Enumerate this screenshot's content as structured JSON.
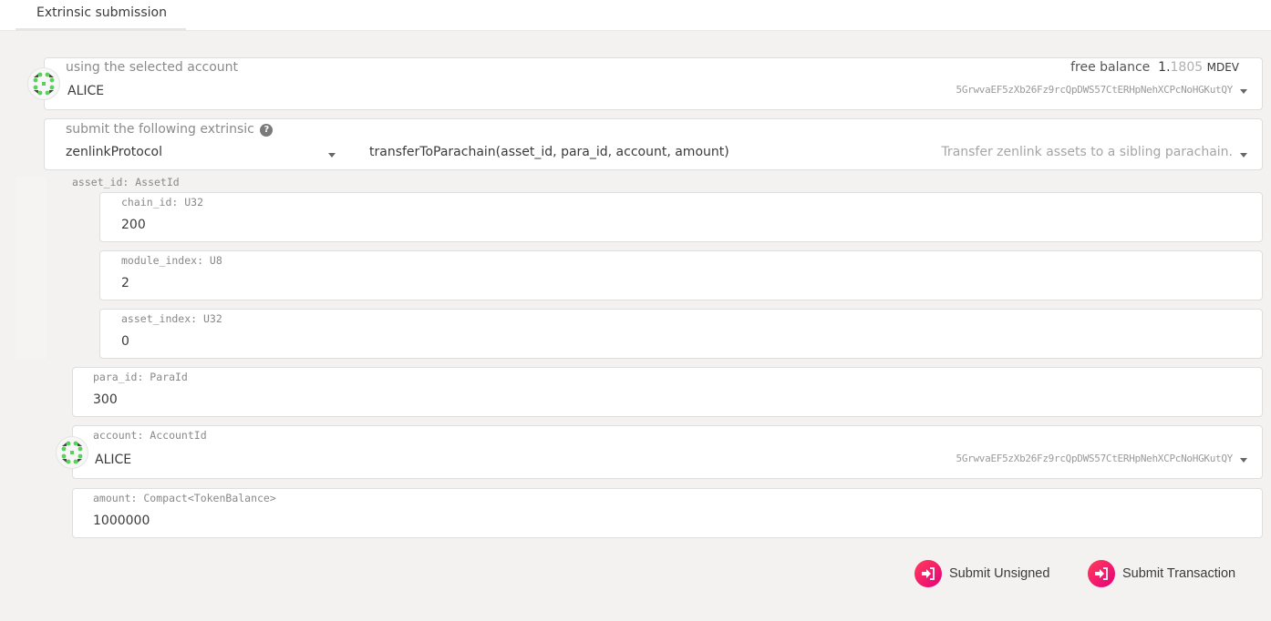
{
  "tabs": [
    {
      "label": "Extrinsic submission",
      "active": true
    }
  ],
  "account": {
    "label": "using the selected account",
    "name": "ALICE",
    "address": "5GrwvaEF5zXb26Fz9rcQpDWS57CtERHpNehXCPcNoHGKutQY",
    "balance_label": "free balance",
    "balance_int": "1.",
    "balance_dec": "1805",
    "balance_unit": "MDEV"
  },
  "extrinsic": {
    "label": "submit the following extrinsic",
    "help_icon": "?",
    "section": "zenlinkProtocol",
    "method": "transferToParachain(asset_id, para_id, account, amount)",
    "description": "Transfer zenlink assets to a sibling parachain."
  },
  "params": {
    "asset_id": {
      "label": "asset_id: AssetId",
      "fields": [
        {
          "label": "chain_id: U32",
          "value": "200"
        },
        {
          "label": "module_index: U8",
          "value": "2"
        },
        {
          "label": "asset_index: U32",
          "value": "0"
        }
      ]
    },
    "para_id": {
      "label": "para_id: ParaId",
      "value": "300"
    },
    "account": {
      "label": "account: AccountId",
      "name": "ALICE",
      "address": "5GrwvaEF5zXb26Fz9rcQpDWS57CtERHpNehXCPcNoHGKutQY"
    },
    "amount": {
      "label": "amount: Compact<TokenBalance>",
      "value": "1000000"
    }
  },
  "actions": {
    "submit_unsigned": "Submit Unsigned",
    "submit_transaction": "Submit Transaction"
  },
  "colors": {
    "accent_start": "#ff3d5a",
    "accent_end": "#e6007a",
    "identicon_green": "#5ad15a"
  }
}
